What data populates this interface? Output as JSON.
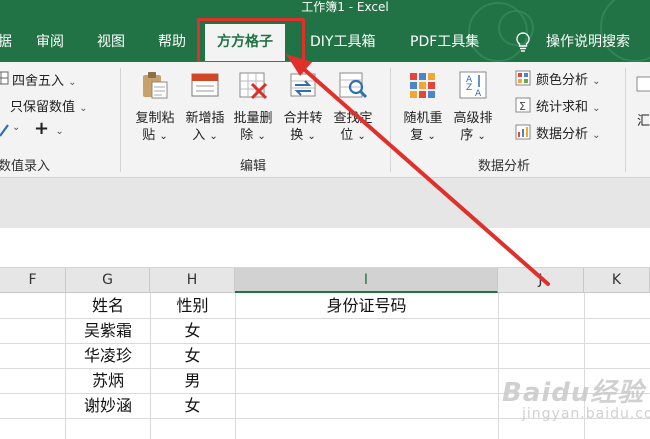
{
  "window": {
    "title": "工作簿1  -  Excel"
  },
  "tabs": [
    {
      "label": "据"
    },
    {
      "label": "审阅"
    },
    {
      "label": "视图"
    },
    {
      "label": "帮助"
    },
    {
      "label": "方方格子",
      "active": true
    },
    {
      "label": "DIY工具箱"
    },
    {
      "label": "PDF工具集"
    },
    {
      "label": "操作说明搜索"
    }
  ],
  "ribbon": {
    "left_group": {
      "round": "四舍五入",
      "keep_value": "只保留数值",
      "plus": "+",
      "group_label": "数值录入"
    },
    "edit_group": {
      "buttons": [
        {
          "label_top": "复制粘",
          "label_bottom": "贴"
        },
        {
          "label_top": "新增插",
          "label_bottom": "入"
        },
        {
          "label_top": "批量删",
          "label_bottom": "除"
        },
        {
          "label_top": "合并转",
          "label_bottom": "换"
        },
        {
          "label_top": "查找定",
          "label_bottom": "位"
        }
      ],
      "group_label": "编辑"
    },
    "analysis_group": {
      "buttons": [
        {
          "label_top": "随机重",
          "label_bottom": "复"
        },
        {
          "label_top": "高级排",
          "label_bottom": "序"
        }
      ],
      "items": [
        "颜色分析",
        "统计求和",
        "数据分析"
      ],
      "group_label": "数据分析"
    },
    "right_partial": {
      "label_top": "汇"
    }
  },
  "sort_icon_text": {
    "top": "A",
    "mid": "Z",
    "bot": "A"
  },
  "columns": [
    "F",
    "G",
    "H",
    "I",
    "J",
    "K"
  ],
  "table": {
    "headers": [
      "姓名",
      "性别",
      "身份证号码"
    ],
    "rows": [
      [
        "吴紫霜",
        "女"
      ],
      [
        "华凌珍",
        "女"
      ],
      [
        "苏炳",
        "男"
      ],
      [
        "谢妙涵",
        "女"
      ]
    ]
  },
  "watermark": {
    "brand": "Baidu经验",
    "sub": "jingyan.baidu.com"
  },
  "colors": {
    "excel_green": "#217346",
    "highlight_red": "#e0302b",
    "ribbon_bg": "#f3f3f3"
  }
}
